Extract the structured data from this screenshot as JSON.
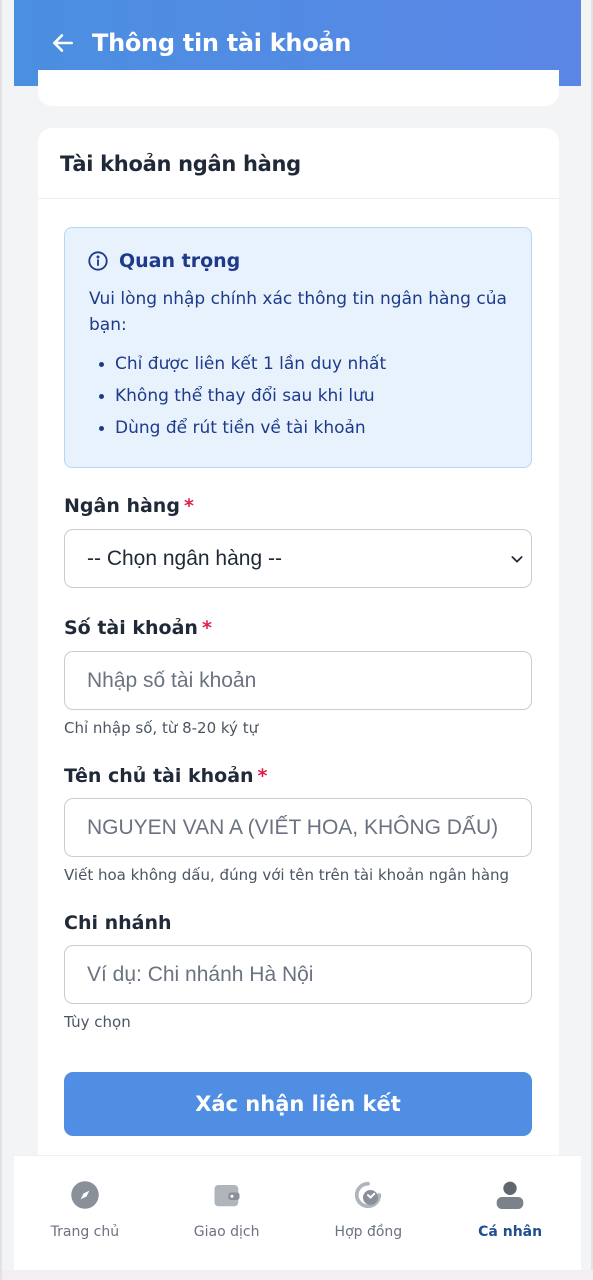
{
  "header": {
    "title": "Thông tin tài khoản",
    "back_icon": "arrow-left-icon"
  },
  "card": {
    "title": "Tài khoản ngân hàng",
    "notice": {
      "title": "Quan trọng",
      "icon": "info-circle-icon",
      "description": "Vui lòng nhập chính xác thông tin ngân hàng của bạn:",
      "items": [
        "Chỉ được liên kết 1 lần duy nhất",
        "Không thể thay đổi sau khi lưu",
        "Dùng để rút tiền về tài khoản"
      ]
    },
    "bank": {
      "label": "Ngân hàng",
      "required_mark": "*",
      "selected": "-- Chọn ngân hàng --"
    },
    "account_number": {
      "label": "Số tài khoản",
      "required_mark": "*",
      "placeholder": "Nhập số tài khoản",
      "hint": "Chỉ nhập số, từ 8-20 ký tự"
    },
    "account_name": {
      "label": "Tên chủ tài khoản",
      "required_mark": "*",
      "placeholder": "NGUYEN VAN A (VIẾT HOA, KHÔNG DẤU)",
      "hint": "Viết hoa không dấu, đúng với tên trên tài khoản ngân hàng"
    },
    "branch": {
      "label": "Chi nhánh",
      "placeholder": "Ví dụ: Chi nhánh Hà Nội",
      "hint": "Tùy chọn"
    },
    "submit_label": "Xác nhận liên kết"
  },
  "bottom_nav": {
    "items": [
      {
        "label": "Trang chủ",
        "icon": "compass-icon",
        "active": false
      },
      {
        "label": "Giao dịch",
        "icon": "wallet-icon",
        "active": false
      },
      {
        "label": "Hợp đồng",
        "icon": "refresh-icon",
        "active": false
      },
      {
        "label": "Cá nhân",
        "icon": "user-icon",
        "active": true
      }
    ]
  },
  "colors": {
    "primary": "#4f8ee3",
    "header_start": "#4a8fe0",
    "header_end": "#5b86e6",
    "required": "#e11d48",
    "notice_text": "#1e3a8a"
  }
}
